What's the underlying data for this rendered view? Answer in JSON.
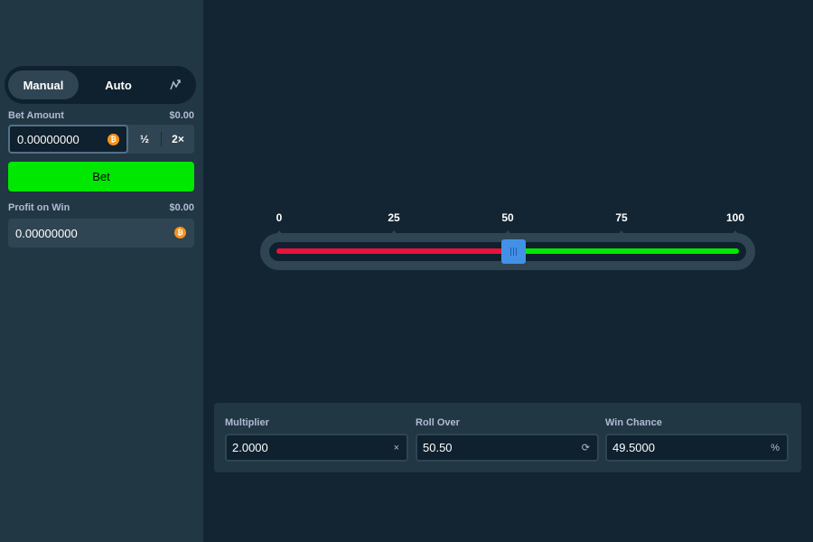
{
  "sidebar": {
    "modes": [
      "Manual",
      "Auto"
    ],
    "bet_amount_label": "Bet Amount",
    "bet_amount_usd": "$0.00",
    "bet_value": "0.00000000",
    "half_label": "½",
    "double_label": "2×",
    "bet_button_label": "Bet",
    "profit_label": "Profit on Win",
    "profit_usd": "$0.00",
    "profit_value": "0.00000000",
    "currency_icon": "bitcoin-icon"
  },
  "slider": {
    "ticks": [
      "0",
      "25",
      "50",
      "75",
      "100"
    ],
    "value": 50.5
  },
  "panel": {
    "multiplier_label": "Multiplier",
    "multiplier_value": "2.0000",
    "multiplier_icon": "×",
    "roll_label": "Roll Over",
    "roll_value": "50.50",
    "roll_icon": "⟳",
    "chance_label": "Win Chance",
    "chance_value": "49.5000",
    "chance_icon": "%"
  },
  "colors": {
    "accent_green": "#00e701",
    "loss_red": "#e9113c",
    "handle_blue": "#4391e7"
  }
}
